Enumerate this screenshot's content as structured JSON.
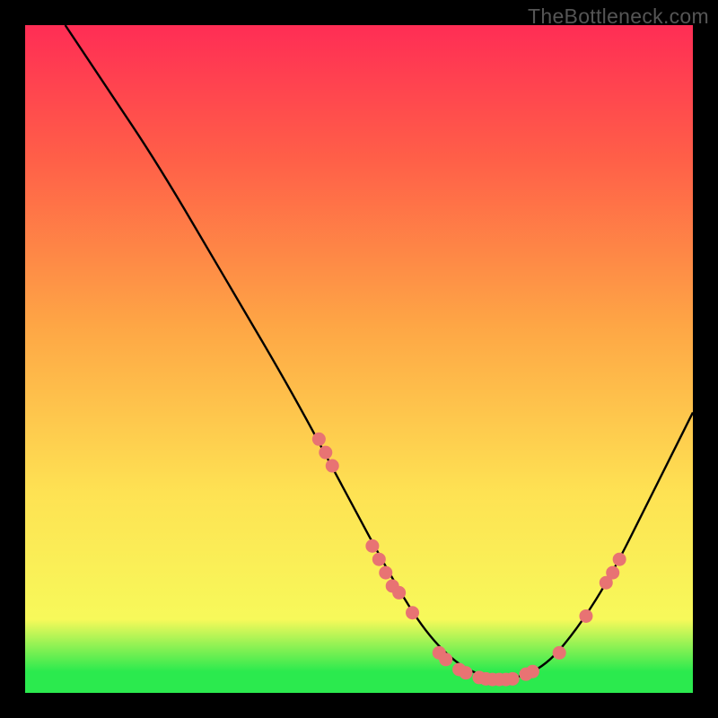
{
  "watermark": "TheBottleneck.com",
  "chart_data": {
    "type": "line",
    "title": "",
    "xlabel": "",
    "ylabel": "",
    "xlim": [
      0,
      100
    ],
    "ylim": [
      0,
      100
    ],
    "curve": [
      {
        "x": 6,
        "y": 100
      },
      {
        "x": 12,
        "y": 91
      },
      {
        "x": 20,
        "y": 79
      },
      {
        "x": 30,
        "y": 62
      },
      {
        "x": 40,
        "y": 45
      },
      {
        "x": 48,
        "y": 30
      },
      {
        "x": 55,
        "y": 17
      },
      {
        "x": 60,
        "y": 9
      },
      {
        "x": 65,
        "y": 4
      },
      {
        "x": 70,
        "y": 2
      },
      {
        "x": 73,
        "y": 2
      },
      {
        "x": 78,
        "y": 4
      },
      {
        "x": 83,
        "y": 10
      },
      {
        "x": 88,
        "y": 18
      },
      {
        "x": 93,
        "y": 28
      },
      {
        "x": 98,
        "y": 38
      },
      {
        "x": 100,
        "y": 42
      }
    ],
    "markers": [
      {
        "x": 44,
        "y": 38
      },
      {
        "x": 45,
        "y": 36
      },
      {
        "x": 46,
        "y": 34
      },
      {
        "x": 52,
        "y": 22
      },
      {
        "x": 53,
        "y": 20
      },
      {
        "x": 54,
        "y": 18
      },
      {
        "x": 55,
        "y": 16
      },
      {
        "x": 56,
        "y": 15
      },
      {
        "x": 58,
        "y": 12
      },
      {
        "x": 62,
        "y": 6
      },
      {
        "x": 63,
        "y": 5
      },
      {
        "x": 65,
        "y": 3.5
      },
      {
        "x": 66,
        "y": 3
      },
      {
        "x": 68,
        "y": 2.3
      },
      {
        "x": 69,
        "y": 2.1
      },
      {
        "x": 70,
        "y": 2
      },
      {
        "x": 71,
        "y": 2
      },
      {
        "x": 72,
        "y": 2
      },
      {
        "x": 73,
        "y": 2.1
      },
      {
        "x": 75,
        "y": 2.8
      },
      {
        "x": 76,
        "y": 3.2
      },
      {
        "x": 80,
        "y": 6
      },
      {
        "x": 84,
        "y": 11.5
      },
      {
        "x": 87,
        "y": 16.5
      },
      {
        "x": 88,
        "y": 18
      },
      {
        "x": 89,
        "y": 20
      }
    ],
    "marker_color": "#e87373",
    "curve_color": "#000000"
  }
}
